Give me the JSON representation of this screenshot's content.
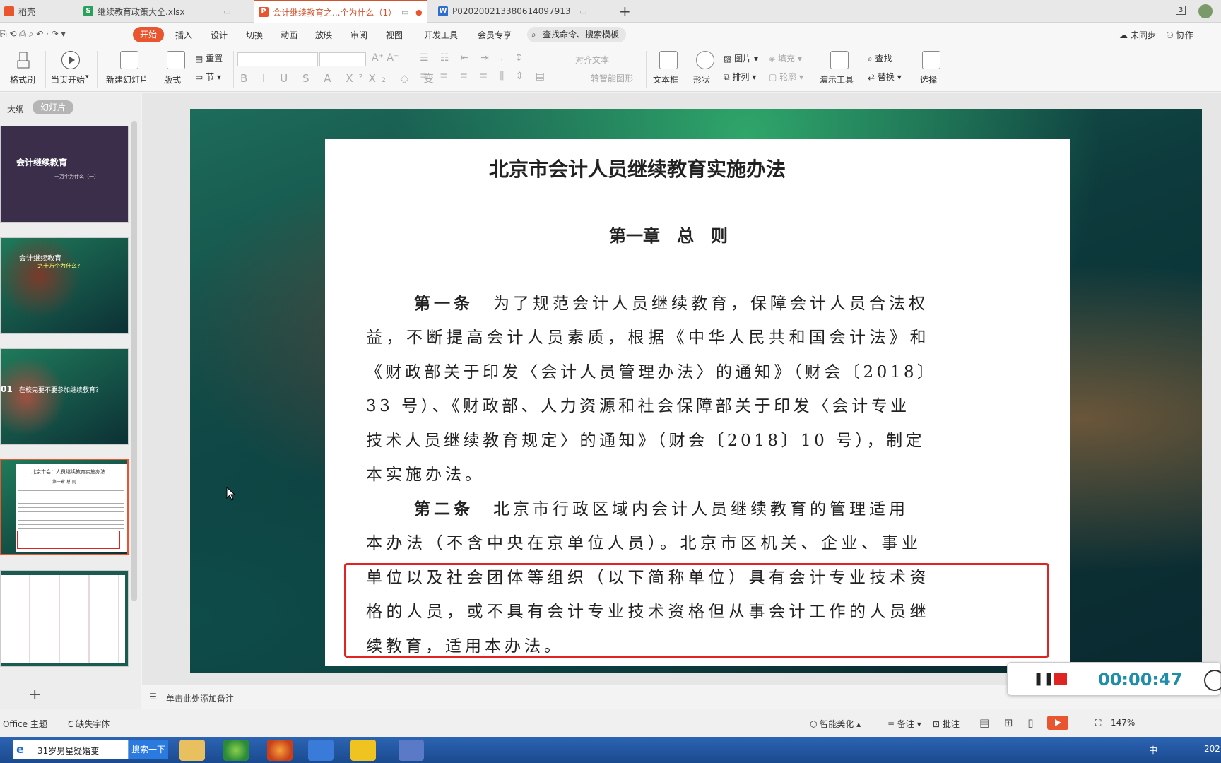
{
  "tabs": [
    {
      "label": "稻壳",
      "icon": "docer-icon"
    },
    {
      "label": "继续教育政策大全.xlsx",
      "icon": "spreadsheet-icon"
    },
    {
      "label": "会计继续教育之...个为什么（1）",
      "icon": "presentation-icon",
      "active": true
    },
    {
      "label": "P020200213380614097913",
      "icon": "document-icon"
    }
  ],
  "tab_add": "+",
  "window_counter": "3",
  "menu": {
    "items": [
      "开始",
      "插入",
      "设计",
      "切换",
      "动画",
      "放映",
      "审阅",
      "视图",
      "开发工具",
      "会员专享"
    ],
    "search_placeholder": "查找命令、搜索模板",
    "right": [
      "未同步",
      "协作"
    ]
  },
  "ribbon": {
    "format_painter": "格式刷",
    "play_from_current": "当页开始",
    "new_slide": "新建幻灯片",
    "layout": "版式",
    "reset": "重置",
    "section": "节",
    "align_text": "对齐文本",
    "smart_shape": "转智能图形",
    "textbox": "文本框",
    "shape": "形状",
    "picture": "图片",
    "fill": "填充",
    "arrange": "排列",
    "outline": "轮廓",
    "present_tools": "演示工具",
    "find": "查找",
    "replace": "替换",
    "select": "选择"
  },
  "panel": {
    "outline_tab": "大纲",
    "slides_tab": "幻灯片",
    "add": "+"
  },
  "thumbnails": [
    {
      "title": "会计继续教育",
      "subtitle": "十万个为什么（一）"
    },
    {
      "title": "会计继续教育",
      "subtitle": "之十万个为什么?"
    },
    {
      "title": "在校完要不要参加继续教育？",
      "number": "01"
    },
    {
      "title": "北京市会计人员继续教育实施办法",
      "subtitle": "第一章 总 则"
    },
    {
      "title": ""
    }
  ],
  "document": {
    "title": "北京市会计人员继续教育实施办法",
    "chapter": "第一章　总　则",
    "lines": [
      {
        "bold": "第一条",
        "text": "为了规范会计人员继续教育，保障会计人员合法权"
      },
      {
        "text": "益，不断提高会计人员素质，根据《中华人民共和国会计法》和"
      },
      {
        "text": "《财政部关于印发〈会计人员管理办法〉的通知》（财会〔2018〕"
      },
      {
        "text": "33 号）、《财政部、人力资源和社会保障部关于印发〈会计专业"
      },
      {
        "text": "技术人员继续教育规定〉的通知》（财会〔2018〕10 号），制定"
      },
      {
        "text": "本实施办法。"
      },
      {
        "bold": "第二条",
        "text": "北京市行政区域内会计人员继续教育的管理适用"
      },
      {
        "text": "本办法（不含中央在京单位人员）。北京市区机关、企业、事业"
      },
      {
        "text": "单位以及社会团体等组织（以下简称单位）具有会计专业技术资"
      },
      {
        "text": "格的人员，或不具有会计专业技术资格但从事会计工作的人员继"
      },
      {
        "text": "续教育，适用本办法。"
      }
    ]
  },
  "notes_placeholder": "单击此处添加备注",
  "status": {
    "theme": "Office 主题",
    "missing_font": "缺失字体",
    "beautify": "智能美化",
    "notes": "备注",
    "comments": "批注",
    "zoom": "147%"
  },
  "recorder": {
    "timer": "00:00:47"
  },
  "taskbar": {
    "search_text": "31岁男星疑婚变",
    "search_button": "搜索一下",
    "ime": "中",
    "clock": "202"
  },
  "colors": {
    "accent": "#e8552e",
    "highlight_box": "#e02424",
    "timer": "#1f8ea8"
  }
}
